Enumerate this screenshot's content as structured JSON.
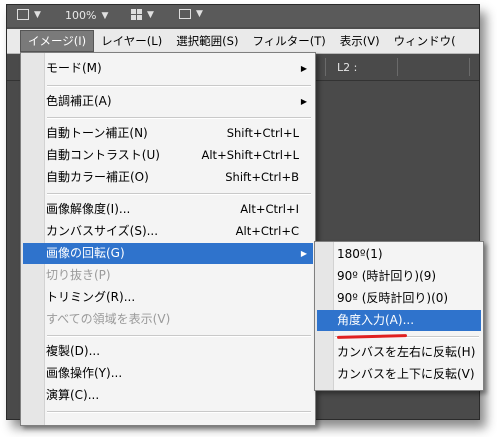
{
  "toolbar": {
    "zoom": "100%"
  },
  "menubar": {
    "items": [
      {
        "label": "イメージ(I)"
      },
      {
        "label": "レイヤー(L)"
      },
      {
        "label": "選択範囲(S)"
      },
      {
        "label": "フィルター(T)"
      },
      {
        "label": "表示(V)"
      },
      {
        "label": "ウィンドウ("
      }
    ]
  },
  "options_bar": {
    "l2_label": "L2 :"
  },
  "image_menu": {
    "items": [
      {
        "label": "モード(M)",
        "shortcut": "",
        "submenu": true
      },
      {
        "label": "色調補正(A)",
        "shortcut": "",
        "submenu": true
      },
      {
        "label": "自動トーン補正(N)",
        "shortcut": "Shift+Ctrl+L"
      },
      {
        "label": "自動コントラスト(U)",
        "shortcut": "Alt+Shift+Ctrl+L"
      },
      {
        "label": "自動カラー補正(O)",
        "shortcut": "Shift+Ctrl+B"
      },
      {
        "label": "画像解像度(I)...",
        "shortcut": "Alt+Ctrl+I"
      },
      {
        "label": "カンバスサイズ(S)...",
        "shortcut": "Alt+Ctrl+C"
      },
      {
        "label": "画像の回転(G)",
        "shortcut": "",
        "submenu": true,
        "highlighted": true
      },
      {
        "label": "切り抜き(P)",
        "shortcut": "",
        "disabled": true
      },
      {
        "label": "トリミング(R)...",
        "shortcut": ""
      },
      {
        "label": "すべての領域を表示(V)",
        "shortcut": "",
        "disabled": true
      },
      {
        "label": "複製(D)...",
        "shortcut": ""
      },
      {
        "label": "画像操作(Y)...",
        "shortcut": ""
      },
      {
        "label": "演算(C)...",
        "shortcut": ""
      }
    ]
  },
  "rotate_submenu": {
    "items": [
      {
        "label": "180º(1)"
      },
      {
        "label": "90º (時計回り)(9)"
      },
      {
        "label": "90º (反時計回り)(0)"
      },
      {
        "label": "角度入力(A)...",
        "highlighted": true
      },
      {
        "label": "カンバスを左右に反転(H)"
      },
      {
        "label": "カンバスを上下に反転(V)"
      }
    ]
  },
  "colors": {
    "highlight": "#2f73cc",
    "annotation_underline": "#e02020"
  }
}
